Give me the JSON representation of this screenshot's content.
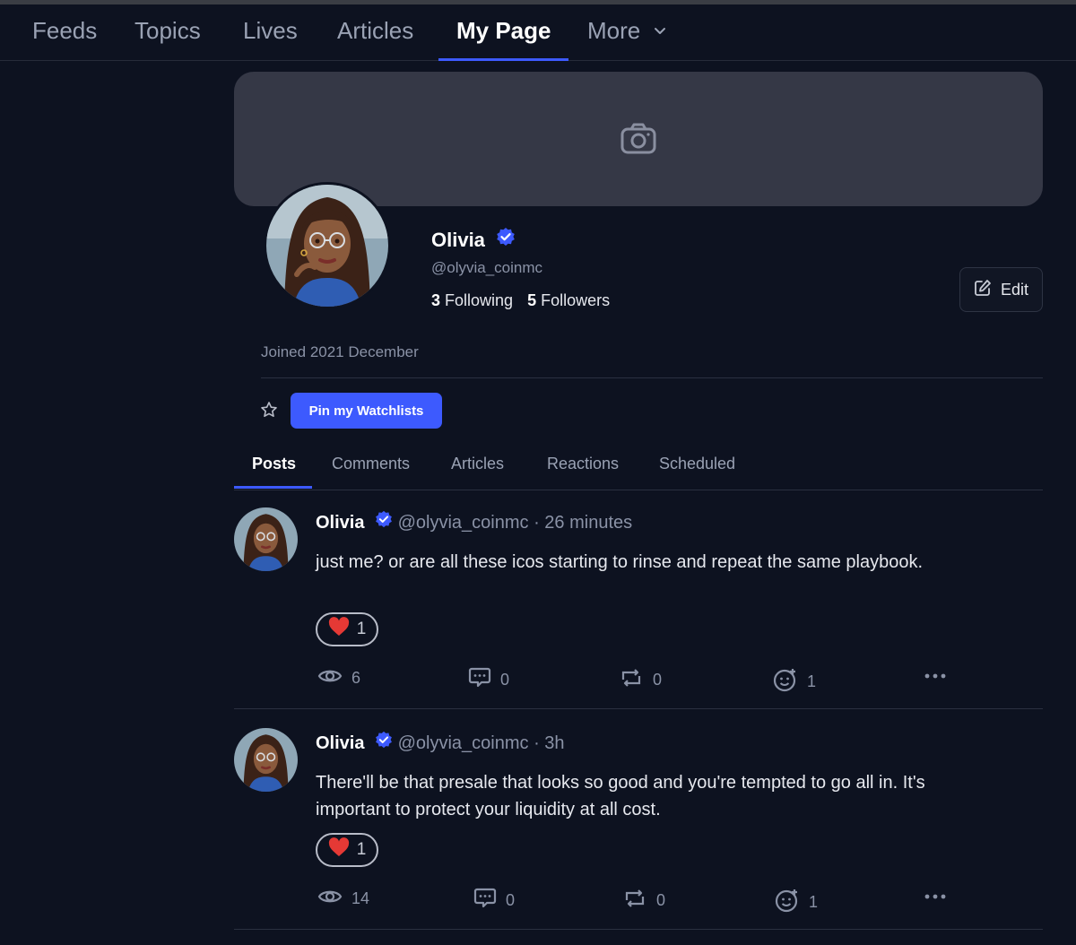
{
  "nav": {
    "items": [
      {
        "label": "Feeds"
      },
      {
        "label": "Topics"
      },
      {
        "label": "Lives"
      },
      {
        "label": "Articles"
      },
      {
        "label": "My Page",
        "active": true
      },
      {
        "label": "More"
      }
    ]
  },
  "profile": {
    "name": "Olivia",
    "handle": "@olyvia_coinmc",
    "following_count": "3",
    "following_label": "Following",
    "followers_count": "5",
    "followers_label": "Followers",
    "edit_label": "Edit",
    "joined": "Joined 2021 December",
    "pin_label": "Pin my Watchlists"
  },
  "tabs": [
    {
      "label": "Posts",
      "active": true
    },
    {
      "label": "Comments"
    },
    {
      "label": "Articles"
    },
    {
      "label": "Reactions"
    },
    {
      "label": "Scheduled"
    }
  ],
  "posts": [
    {
      "name": "Olivia",
      "handle": "@olyvia_coinmc",
      "time": "· 26 minutes",
      "text": "just me? or are all these icos starting to rinse and repeat the same playbook.",
      "reaction_count": "1",
      "views": "6",
      "comments": "0",
      "reposts": "0",
      "reacts": "1"
    },
    {
      "name": "Olivia",
      "handle": "@olyvia_coinmc",
      "time": "· 3h",
      "text": "There'll be that presale that looks so good and you're tempted to go all in. It's important to protect your liquidity at all cost.",
      "reaction_count": "1",
      "views": "14",
      "comments": "0",
      "reposts": "0",
      "reacts": "1"
    }
  ],
  "colors": {
    "background": "#0d1220",
    "accent": "#3d5afe",
    "cover": "#353846",
    "muted": "#8a92a6"
  }
}
